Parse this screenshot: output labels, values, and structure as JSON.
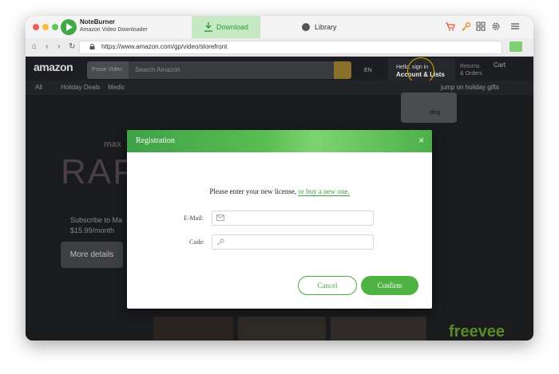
{
  "app": {
    "name": "NoteBurner",
    "subtitle": "Amazon Video Downloader"
  },
  "tabs": [
    {
      "label": "Download",
      "icon": "download-icon",
      "active": true
    },
    {
      "label": "Library",
      "icon": "clock-icon",
      "active": false
    }
  ],
  "toolbar_icons": [
    "cart-icon",
    "key-icon",
    "grid-icon",
    "gear-icon",
    "menu-icon"
  ],
  "browser": {
    "url": "https://www.amazon.com/gp/video/storefront"
  },
  "amazon": {
    "logo": "amazon",
    "search_category": "Prime Video",
    "search_placeholder": "Search Amazon",
    "language": "EN",
    "account_greeting": "Hello, sign in",
    "account_label": "Account & Lists",
    "returns_line1": "Returns",
    "returns_line2": "& Orders",
    "cart_label": "Cart",
    "subnav": [
      "All",
      "Holiday Deals",
      "Medic"
    ],
    "promo": "jump on holiday gifts",
    "popup_text": "ding",
    "hero_brand": "max",
    "hero_title": "RAP",
    "hero_sub1": "Subscribe to Ma",
    "hero_sub2": "$15.99/month",
    "hero_button": "More details",
    "freevee": "freevee"
  },
  "dialog": {
    "title": "Registration",
    "prompt": "Please enter your new license,",
    "buy_link": "or buy a new one.",
    "email_label": "E-Mail:",
    "code_label": "Code:",
    "email_value": "",
    "code_value": "",
    "cancel": "Cancel",
    "confirm": "Confirm"
  },
  "colors": {
    "accent": "#4fb344",
    "tab_active_bg": "#c6e9c3",
    "site_bg": "#1a1b1d"
  }
}
